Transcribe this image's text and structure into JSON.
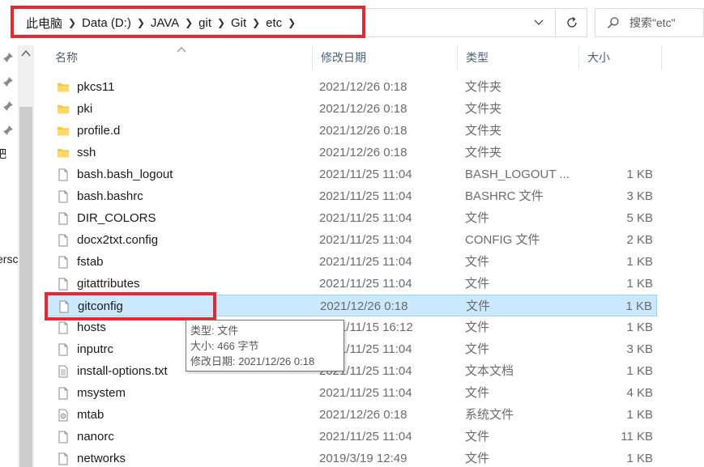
{
  "address": {
    "crumbs": [
      "此电脑",
      "Data (D:)",
      "JAVA",
      "git",
      "Git",
      "etc"
    ]
  },
  "search": {
    "placeholder": "搜索\"etc\""
  },
  "nav_fragments": [
    "吧",
    "ersc"
  ],
  "columns": {
    "name": "名称",
    "date": "修改日期",
    "type": "类型",
    "size": "大小"
  },
  "files": [
    {
      "name": "pkcs11",
      "date": "2021/12/26 0:18",
      "type": "文件夹",
      "size": "",
      "icon": "folder-icon"
    },
    {
      "name": "pki",
      "date": "2021/12/26 0:18",
      "type": "文件夹",
      "size": "",
      "icon": "folder-icon"
    },
    {
      "name": "profile.d",
      "date": "2021/12/26 0:18",
      "type": "文件夹",
      "size": "",
      "icon": "folder-icon"
    },
    {
      "name": "ssh",
      "date": "2021/12/26 0:18",
      "type": "文件夹",
      "size": "",
      "icon": "folder-icon"
    },
    {
      "name": "bash.bash_logout",
      "date": "2021/11/25 11:04",
      "type": "BASH_LOGOUT ...",
      "size": "1 KB",
      "icon": "file-icon"
    },
    {
      "name": "bash.bashrc",
      "date": "2021/11/25 11:04",
      "type": "BASHRC 文件",
      "size": "3 KB",
      "icon": "file-icon"
    },
    {
      "name": "DIR_COLORS",
      "date": "2021/11/25 11:04",
      "type": "文件",
      "size": "5 KB",
      "icon": "file-icon"
    },
    {
      "name": "docx2txt.config",
      "date": "2021/11/25 11:04",
      "type": "CONFIG 文件",
      "size": "2 KB",
      "icon": "file-icon"
    },
    {
      "name": "fstab",
      "date": "2021/11/25 11:04",
      "type": "文件",
      "size": "1 KB",
      "icon": "file-icon"
    },
    {
      "name": "gitattributes",
      "date": "2021/11/25 11:04",
      "type": "文件",
      "size": "1 KB",
      "icon": "file-icon"
    },
    {
      "name": "gitconfig",
      "date": "2021/12/26 0:18",
      "type": "文件",
      "size": "1 KB",
      "icon": "file-icon",
      "selected": true
    },
    {
      "name": "hosts",
      "date": "2021/11/15 16:12",
      "type": "文件",
      "size": "1 KB",
      "icon": "file-icon"
    },
    {
      "name": "inputrc",
      "date": "2021/11/25 11:04",
      "type": "文件",
      "size": "3 KB",
      "icon": "file-icon"
    },
    {
      "name": "install-options.txt",
      "date": "2021/11/25 11:04",
      "type": "文本文档",
      "size": "1 KB",
      "icon": "text-file-icon"
    },
    {
      "name": "msystem",
      "date": "2021/11/25 11:04",
      "type": "文件",
      "size": "4 KB",
      "icon": "file-icon"
    },
    {
      "name": "mtab",
      "date": "2021/12/26 0:18",
      "type": "系统文件",
      "size": "1 KB",
      "icon": "system-file-icon"
    },
    {
      "name": "nanorc",
      "date": "2021/11/25 11:04",
      "type": "文件",
      "size": "11 KB",
      "icon": "file-icon"
    },
    {
      "name": "networks",
      "date": "2019/3/19 12:49",
      "type": "文件",
      "size": "1 KB",
      "icon": "file-icon"
    }
  ],
  "tooltip": {
    "type_line": "类型: 文件",
    "size_line": "大小: 466 字节",
    "date_line": "修改日期: 2021/12/26 0:18"
  },
  "colors": {
    "selection": "#cce8ff",
    "highlight": "#e8282e",
    "folder": "#f8c63c"
  }
}
